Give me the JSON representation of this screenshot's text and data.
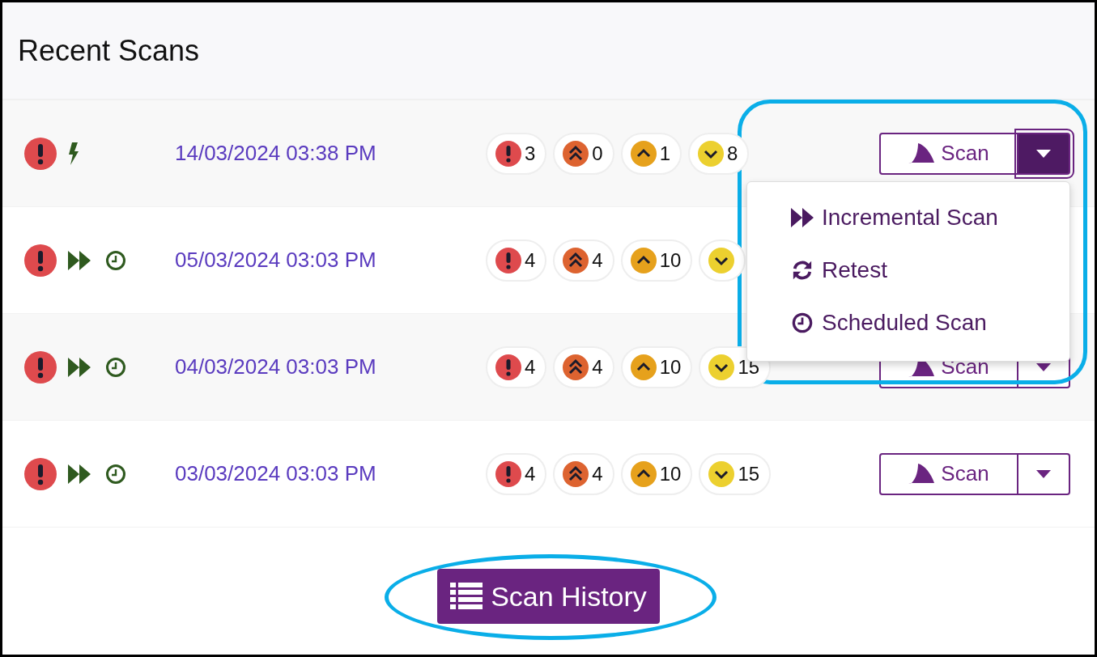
{
  "title": "Recent Scans",
  "rows": [
    {
      "indicators": [
        {
          "kind": "critical"
        },
        {
          "kind": "manual"
        }
      ],
      "date": "14/03/2024 03:38 PM",
      "badges": [
        {
          "kind": "critical",
          "count": "3"
        },
        {
          "kind": "high",
          "count": "0"
        },
        {
          "kind": "medium",
          "count": "1"
        },
        {
          "kind": "low",
          "count": "8"
        }
      ],
      "scan_label": "Scan",
      "menu_open": true
    },
    {
      "indicators": [
        {
          "kind": "critical"
        },
        {
          "kind": "incremental"
        },
        {
          "kind": "scheduled"
        }
      ],
      "date": "05/03/2024 03:03 PM",
      "badges": [
        {
          "kind": "critical",
          "count": "4"
        },
        {
          "kind": "high",
          "count": "4"
        },
        {
          "kind": "medium",
          "count": "10"
        },
        {
          "kind": "low"
        }
      ],
      "menu_open": false
    },
    {
      "indicators": [
        {
          "kind": "critical"
        },
        {
          "kind": "incremental"
        },
        {
          "kind": "scheduled"
        }
      ],
      "date": "04/03/2024 03:03 PM",
      "badges": [
        {
          "kind": "critical",
          "count": "4"
        },
        {
          "kind": "high",
          "count": "4"
        },
        {
          "kind": "medium",
          "count": "10"
        },
        {
          "kind": "low",
          "count": "15"
        }
      ],
      "scan_label": "Scan",
      "menu_open": false
    },
    {
      "indicators": [
        {
          "kind": "critical"
        },
        {
          "kind": "incremental"
        },
        {
          "kind": "scheduled"
        }
      ],
      "date": "03/03/2024 03:03 PM",
      "badges": [
        {
          "kind": "critical",
          "count": "4"
        },
        {
          "kind": "high",
          "count": "4"
        },
        {
          "kind": "medium",
          "count": "10"
        },
        {
          "kind": "low",
          "count": "15"
        }
      ],
      "scan_label": "Scan",
      "menu_open": false
    }
  ],
  "menu": [
    {
      "kind": "incremental",
      "label": "Incremental Scan"
    },
    {
      "kind": "retest",
      "label": "Retest"
    },
    {
      "kind": "scheduled",
      "label": "Scheduled Scan"
    }
  ],
  "history_button": "Scan History"
}
